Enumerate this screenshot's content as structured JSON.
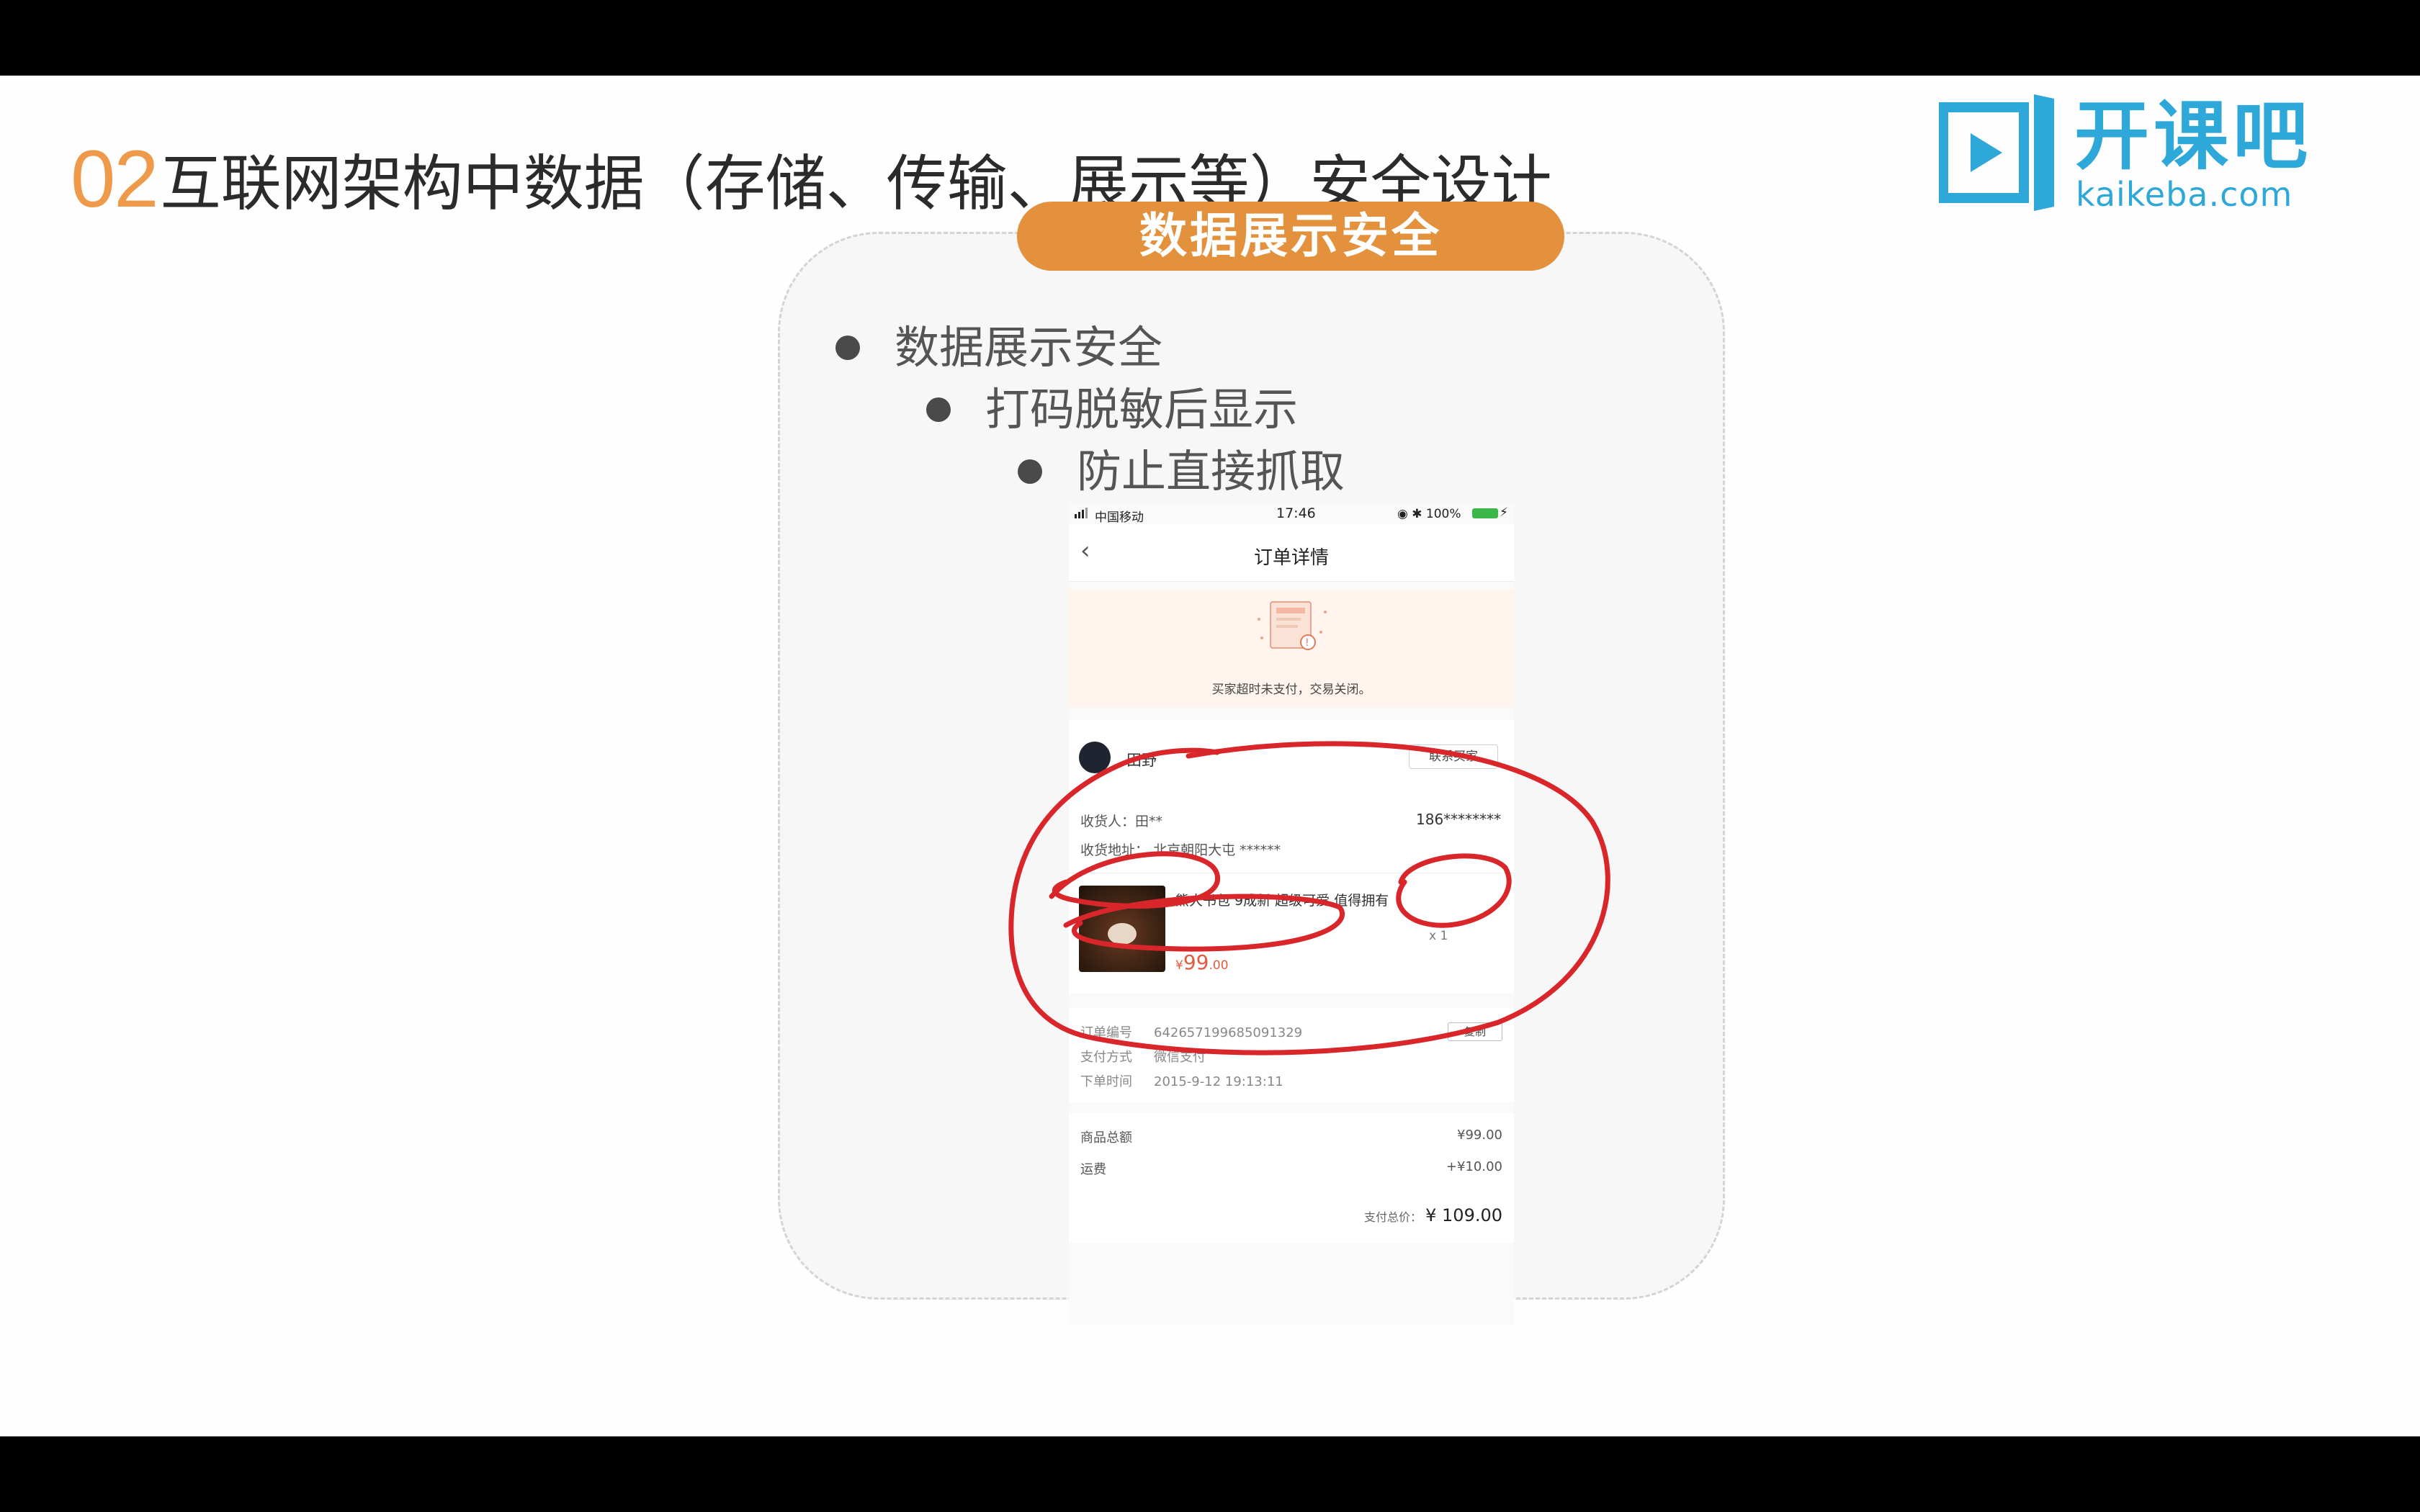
{
  "slide": {
    "title_number": "02",
    "title_text": "互联网架构中数据（存储、传输、展示等）安全设计",
    "logo_cn": "开课吧",
    "logo_en": "kaikeba.com",
    "section_pill": "数据展示安全",
    "bullets": [
      "数据展示安全",
      "打码脱敏后显示",
      "防止直接抓取"
    ]
  },
  "phone": {
    "status_bar": {
      "carrier": "中国移动",
      "time": "17:46",
      "battery": "100%"
    },
    "nav": {
      "back_icon": "chevron-left-icon",
      "title": "订单详情"
    },
    "order_status": "买家超时未支付，交易关闭。",
    "buyer": {
      "name": "田野",
      "contact_button": "联系买家",
      "receiver_label": "收货人：",
      "receiver_value": "田**",
      "phone": "186********",
      "address_label": "收货地址：",
      "address_value": "北京朝阳大屯 ******"
    },
    "product": {
      "name": "熊大书包 9成新 超级可爱 值得拥有",
      "qty": "x 1",
      "price_symbol": "¥",
      "price_int": "99",
      "price_dec": ".00"
    },
    "order": {
      "id_label": "订单编号",
      "id_value": "642657199685091329",
      "copy_button": "复制",
      "pay_label": "支付方式",
      "pay_value": "微信支付",
      "time_label": "下单时间",
      "time_value": "2015-9-12 19:13:11"
    },
    "totals": {
      "goods_label": "商品总额",
      "goods_value": "¥99.00",
      "ship_label": "运费",
      "ship_value": "+¥10.00",
      "paid_label": "支付总价：",
      "paid_value": "¥ 109.00"
    }
  },
  "colors": {
    "accent_orange": "#e3913c",
    "logo_blue": "#2ea8d8",
    "annotation_red": "#d8262a"
  }
}
